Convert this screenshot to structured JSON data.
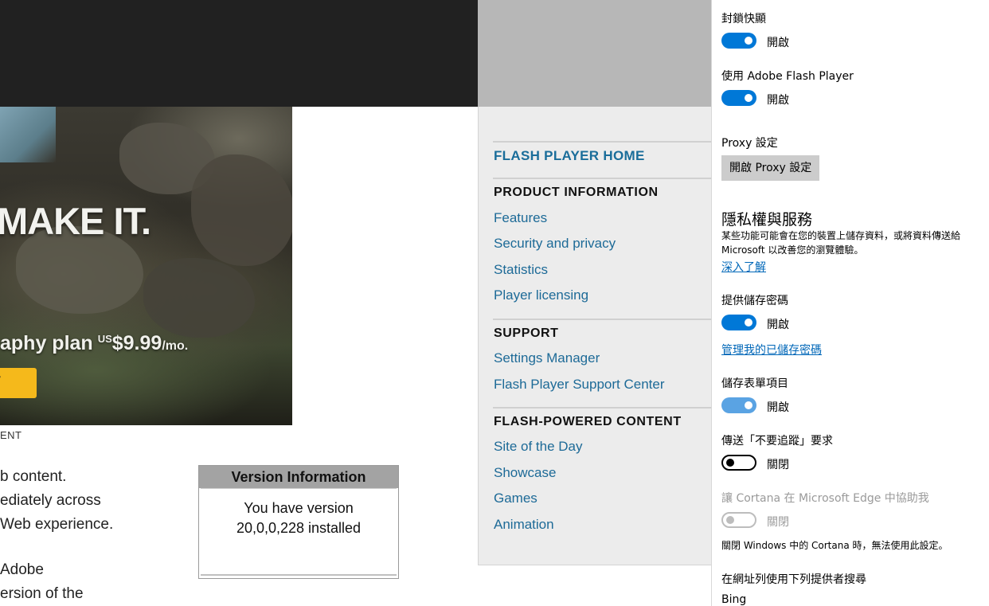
{
  "flash_page": {
    "banner": {
      "headline": "MAKE IT.",
      "plan_text": "aphy plan",
      "price_prefix": "US",
      "price": "$9.99",
      "price_suffix": "/mo.",
      "cta_label": "y"
    },
    "ent_label": "ENT",
    "body_lines": [
      "b content.",
      "ediately across",
      "Web experience.",
      "Adobe",
      "ersion of the"
    ],
    "version_box": {
      "title": "Version Information",
      "line1": "You have version",
      "line2": "20,0,0,228 installed"
    },
    "nav": {
      "home": "FLASH PLAYER HOME",
      "sections": [
        {
          "title": "PRODUCT INFORMATION",
          "links": [
            "Features",
            "Security and privacy",
            "Statistics",
            "Player licensing"
          ]
        },
        {
          "title": "SUPPORT",
          "links": [
            "Settings Manager",
            "Flash Player Support Center"
          ]
        },
        {
          "title": "FLASH-POWERED CONTENT",
          "links": [
            "Site of the Day",
            "Showcase",
            "Games",
            "Animation"
          ]
        }
      ]
    }
  },
  "edge_settings": {
    "block_popups": {
      "label": "封鎖快顯",
      "state": "開啟",
      "on": true
    },
    "flash_player": {
      "label": "使用 Adobe Flash Player",
      "state": "開啟",
      "on": true
    },
    "proxy": {
      "label": "Proxy 設定",
      "button": "開啟 Proxy 設定"
    },
    "privacy": {
      "heading": "隱私權與服務",
      "description": "某些功能可能會在您的裝置上儲存資料，或將資料傳送給 Microsoft 以改善您的瀏覽體驗。",
      "learn_more": "深入了解"
    },
    "save_passwords": {
      "label": "提供儲存密碼",
      "state": "開啟",
      "on": true,
      "manage_link": "管理我的已儲存密碼"
    },
    "save_forms": {
      "label": "儲存表單項目",
      "state": "開啟",
      "on": true
    },
    "do_not_track": {
      "label": "傳送「不要追蹤」要求",
      "state": "關閉",
      "on": false
    },
    "cortana": {
      "label": "讓 Cortana 在 Microsoft Edge 中協助我",
      "state": "關閉",
      "on": false,
      "disabled": true,
      "note": "關閉 Windows 中的 Cortana 時，無法使用此設定。"
    },
    "search_provider": {
      "label": "在網址列使用下列提供者搜尋",
      "value": "Bing"
    }
  },
  "colors": {
    "accent": "#0078d7",
    "link": "#1d6a97",
    "flash_home": "#1a6d9a",
    "cta": "#f5b91b"
  }
}
